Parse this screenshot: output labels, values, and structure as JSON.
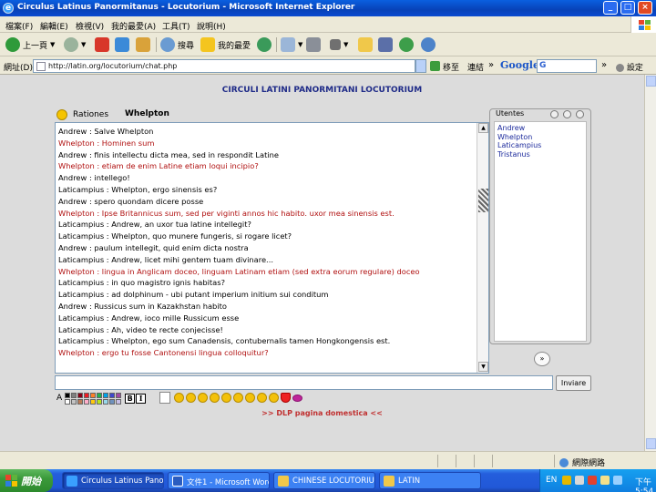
{
  "window": {
    "title": "Circulus Latinus Panormitanus - Locutorium - Microsoft Internet Explorer",
    "min": "_",
    "max": "□",
    "close": "×"
  },
  "menu": {
    "items": [
      "檔案(F)",
      "編輯(E)",
      "檢視(V)",
      "我的最愛(A)",
      "工具(T)",
      "說明(H)"
    ]
  },
  "toolbar": {
    "back": "上一頁",
    "search": "搜尋",
    "favorites": "我的最愛"
  },
  "addressbar": {
    "label": "網址(D)",
    "url": "http://latin.org/locutorium/chat.php",
    "go": "移至",
    "links": "連結",
    "google": "Google",
    "google_g": "G",
    "settings": "設定"
  },
  "page": {
    "heading": "CIRCULI LATINI PANORMITANI LOCUTORIUM",
    "room_label": "Rationes",
    "current_user": "Whelpton",
    "messages": [
      {
        "text": "Andrew : Salve Whelpton",
        "color": "black"
      },
      {
        "text": "Whelpton : Hominen sum",
        "color": "red"
      },
      {
        "text": "Andrew : finis intellectu dicta mea, sed in respondit Latine",
        "color": "black"
      },
      {
        "text": "Whelpton : etiam de enim Latine etiam loqui incipio?",
        "color": "red"
      },
      {
        "text": "Andrew : intellego!",
        "color": "black"
      },
      {
        "text": "Laticampius : Whelpton, ergo sinensis es?",
        "color": "black"
      },
      {
        "text": "Andrew : spero quondam dicere posse",
        "color": "black"
      },
      {
        "text": "Whelpton : Ipse Britannicus sum, sed per viginti annos hic habito. uxor mea sinensis est.",
        "color": "red"
      },
      {
        "text": "Laticampius : Andrew, an uxor tua latine intellegit?",
        "color": "black"
      },
      {
        "text": "Laticampius : Whelpton, quo munere fungeris, si rogare licet?",
        "color": "black"
      },
      {
        "text": "Andrew : paulum intellegit, quid enim dicta nostra",
        "color": "black"
      },
      {
        "text": "Laticampius : Andrew, licet mihi gentem tuam divinare...",
        "color": "black"
      },
      {
        "text": "Whelpton : lingua in Anglicam doceo, linguam Latinam etiam (sed extra eorum regulare) doceo",
        "color": "red"
      },
      {
        "text": "Laticampius : in quo magistro ignis habitas?",
        "color": "black"
      },
      {
        "text": "Laticampius : ad dolphinum - ubi putant imperium initium sui conditum",
        "color": "black"
      },
      {
        "text": "Andrew : Russicus sum in Kazakhstan habito",
        "color": "black"
      },
      {
        "text": "Laticampius : Andrew, ioco mille Russicum esse",
        "color": "black"
      },
      {
        "text": "Laticampius : Ah, video te recte conjecisse!",
        "color": "black"
      },
      {
        "text": "Laticampius : Whelpton, ego sum Canadensis, contubernalis tamen Hongkongensis est.",
        "color": "black"
      },
      {
        "text": "Whelpton : ergo tu fosse Cantonensi lingua colloquitur?",
        "color": "red"
      }
    ],
    "users_panel": {
      "title": "Utentes",
      "users": [
        "Andrew",
        "Whelpton",
        "Laticampius",
        "Tristanus"
      ]
    },
    "send_round": "»",
    "send_button": "Inviare",
    "format": {
      "a": "A",
      "bold": "B",
      "italic": "I",
      "palette": [
        "#000000",
        "#7f7f7f",
        "#880015",
        "#ed1c24",
        "#ff7f27",
        "#22b14c",
        "#00a2e8",
        "#3f48cc",
        "#a349a4",
        "#ffffff",
        "#c3c3c3",
        "#b97a57",
        "#ffaec9",
        "#ffc90e",
        "#b5e61d",
        "#99d9ea",
        "#7092be",
        "#c8bfe7"
      ]
    },
    "home_link": ">> DLP pagina domestica <<"
  },
  "statusbar": {
    "zone": "網際網路"
  },
  "taskbar": {
    "start": "開始",
    "tasks": [
      "Circulus Latinus Panor...",
      "文件1 - Microsoft Word",
      "CHINESE LOCUTORIUM",
      "LATIN"
    ],
    "lang": "EN",
    "clock": "下午 5:54"
  }
}
